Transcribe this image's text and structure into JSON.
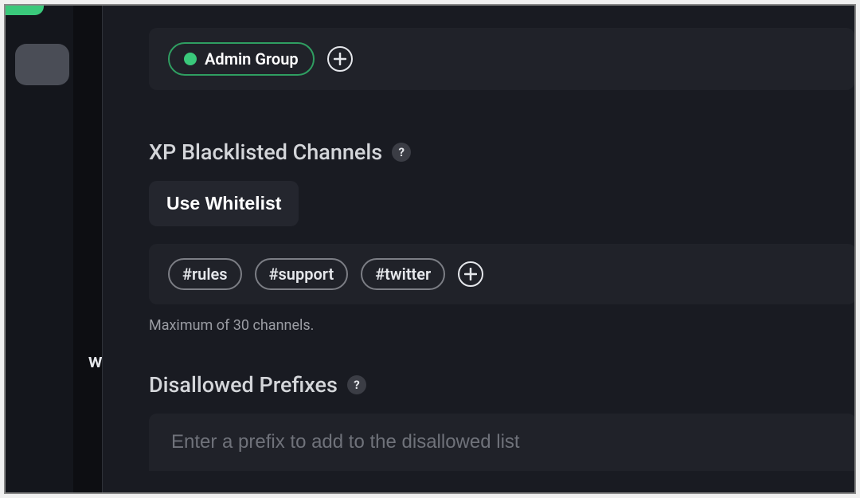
{
  "sidebar": {
    "fragment_label": "wn"
  },
  "roles": {
    "admin_group_label": "Admin Group"
  },
  "blacklisted": {
    "title": "XP Blacklisted Channels",
    "whitelist_button": "Use Whitelist",
    "channels": [
      "#rules",
      "#support",
      "#twitter"
    ],
    "helper": "Maximum of 30 channels."
  },
  "prefixes": {
    "title": "Disallowed Prefixes",
    "placeholder": "Enter a prefix to add to the disallowed list"
  }
}
